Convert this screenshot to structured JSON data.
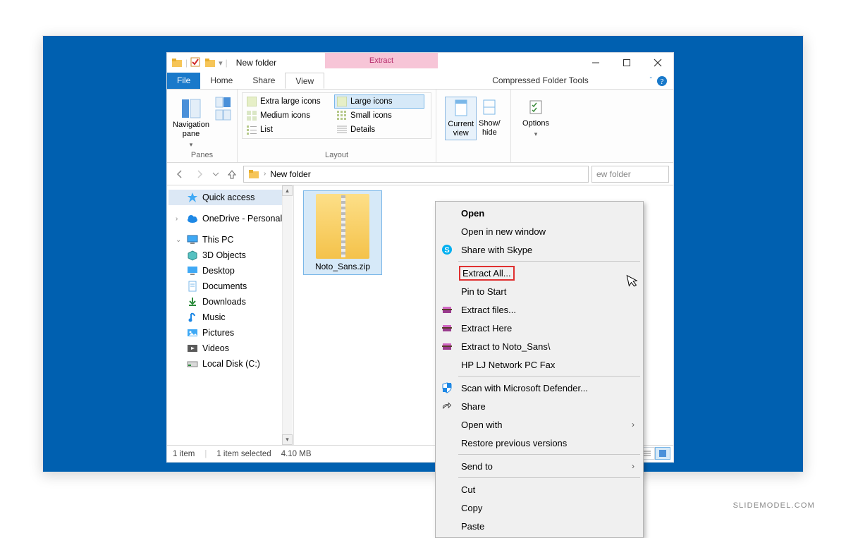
{
  "watermark": "SLIDEMODEL.COM",
  "window": {
    "title": "New folder",
    "context_tab": "Extract",
    "context_tools": "Compressed Folder Tools"
  },
  "menu_tabs": {
    "file": "File",
    "home": "Home",
    "share": "Share",
    "view": "View"
  },
  "ribbon": {
    "panes": {
      "nav_pane": "Navigation\npane",
      "group": "Panes"
    },
    "layout": {
      "extra_large": "Extra large icons",
      "large": "Large icons",
      "medium": "Medium icons",
      "small": "Small icons",
      "list": "List",
      "details": "Details",
      "group": "Layout"
    },
    "current_view": "Current\nview",
    "show_hide": "Show/\nhide",
    "options": "Options"
  },
  "address": {
    "path_root": "",
    "path_label": "New folder",
    "search_placeholder": "ew folder"
  },
  "tree": {
    "quick_access": "Quick access",
    "onedrive": "OneDrive - Personal",
    "this_pc": "This PC",
    "three_d": "3D Objects",
    "desktop": "Desktop",
    "documents": "Documents",
    "downloads": "Downloads",
    "music": "Music",
    "pictures": "Pictures",
    "videos": "Videos",
    "local_disk": "Local Disk (C:)"
  },
  "file": {
    "name": "Noto_Sans.zip"
  },
  "status": {
    "count": "1 item",
    "selected": "1 item selected",
    "size": "4.10 MB"
  },
  "context_menu": {
    "open": "Open",
    "open_new_window": "Open in new window",
    "share_skype": "Share with Skype",
    "extract_all": "Extract All...",
    "pin_start": "Pin to Start",
    "extract_files": "Extract files...",
    "extract_here": "Extract Here",
    "extract_to": "Extract to Noto_Sans\\",
    "hp_fax": "HP LJ Network PC Fax",
    "defender": "Scan with Microsoft Defender...",
    "share": "Share",
    "open_with": "Open with",
    "restore": "Restore previous versions",
    "send_to": "Send to",
    "cut": "Cut",
    "copy": "Copy",
    "paste": "Paste"
  }
}
